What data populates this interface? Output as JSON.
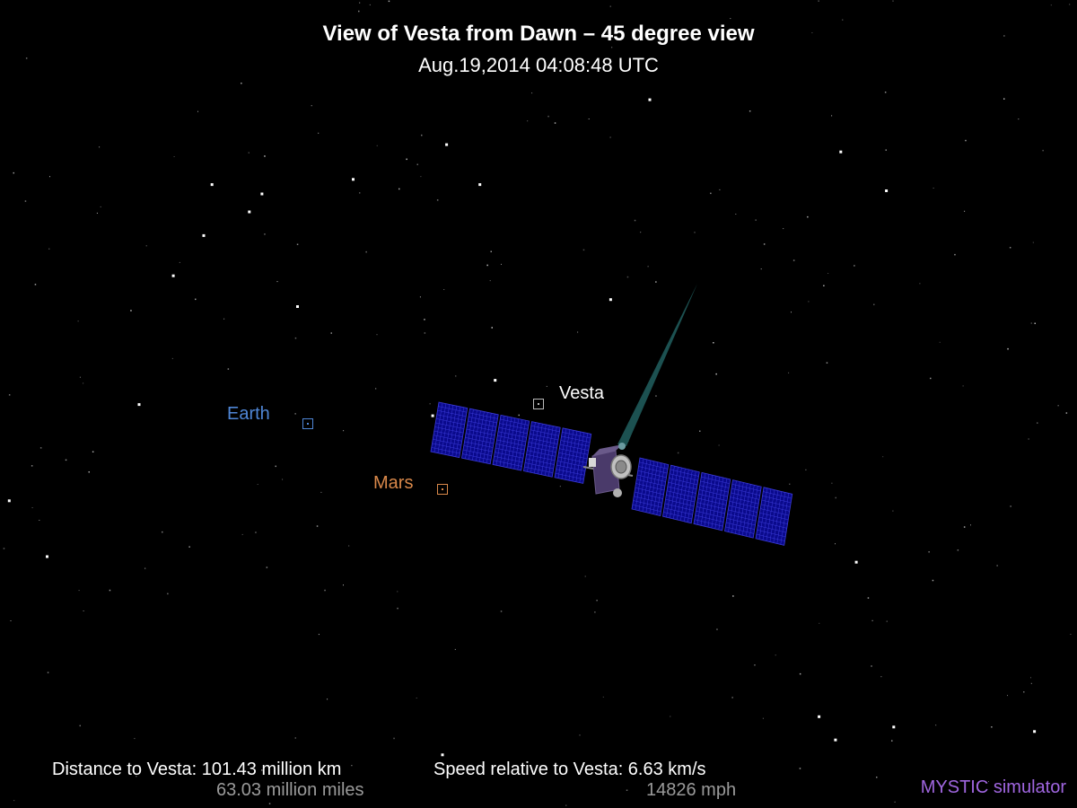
{
  "header": {
    "title": "View of Vesta from Dawn – 45 degree view",
    "timestamp": "Aug.19,2014 04:08:48  UTC"
  },
  "bodies": {
    "vesta": {
      "label": "Vesta",
      "color": "#ffffff"
    },
    "earth": {
      "label": "Earth",
      "color": "#4f86d6"
    },
    "mars": {
      "label": "Mars",
      "color": "#d9884a"
    }
  },
  "spacecraft": {
    "name": "Dawn",
    "panel_color": "#0a0a8c",
    "grid_color": "#3a3ad8",
    "antenna_beam_color": "#1f5a5a"
  },
  "readouts": {
    "distance": {
      "label": "Distance to Vesta: 101.43 million km",
      "secondary": "63.03 million miles"
    },
    "speed": {
      "label": "Speed relative to Vesta: 6.63 km/s",
      "secondary": "14826 mph"
    }
  },
  "credit": {
    "text": "MYSTIC simulator",
    "color": "#a066e0"
  }
}
